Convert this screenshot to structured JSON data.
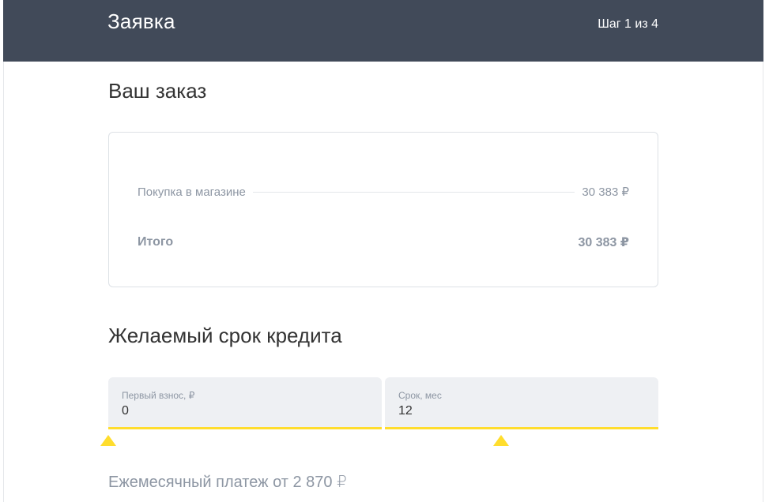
{
  "header": {
    "title": "Заявка",
    "step": "Шаг 1 из 4",
    "background": "#414a59"
  },
  "order": {
    "title": "Ваш заказ",
    "purchase_label": "Покупка в магазине",
    "purchase_amount": "30 383 ₽",
    "total_label": "Итого",
    "total_amount": "30 383 ₽"
  },
  "credit_term": {
    "title": "Желаемый срок кредита",
    "down_payment": {
      "label": "Первый взнос, ₽",
      "value": "0",
      "slider_position": 0
    },
    "term": {
      "label": "Срок, мес",
      "value": "12",
      "slider_position": 0.43
    },
    "accent_color": "#ffdd2d"
  },
  "monthly_payment": "Ежемесячный платеж от 2 870 ₽",
  "icons": {
    "slider_handle": "triangle-up-icon"
  }
}
